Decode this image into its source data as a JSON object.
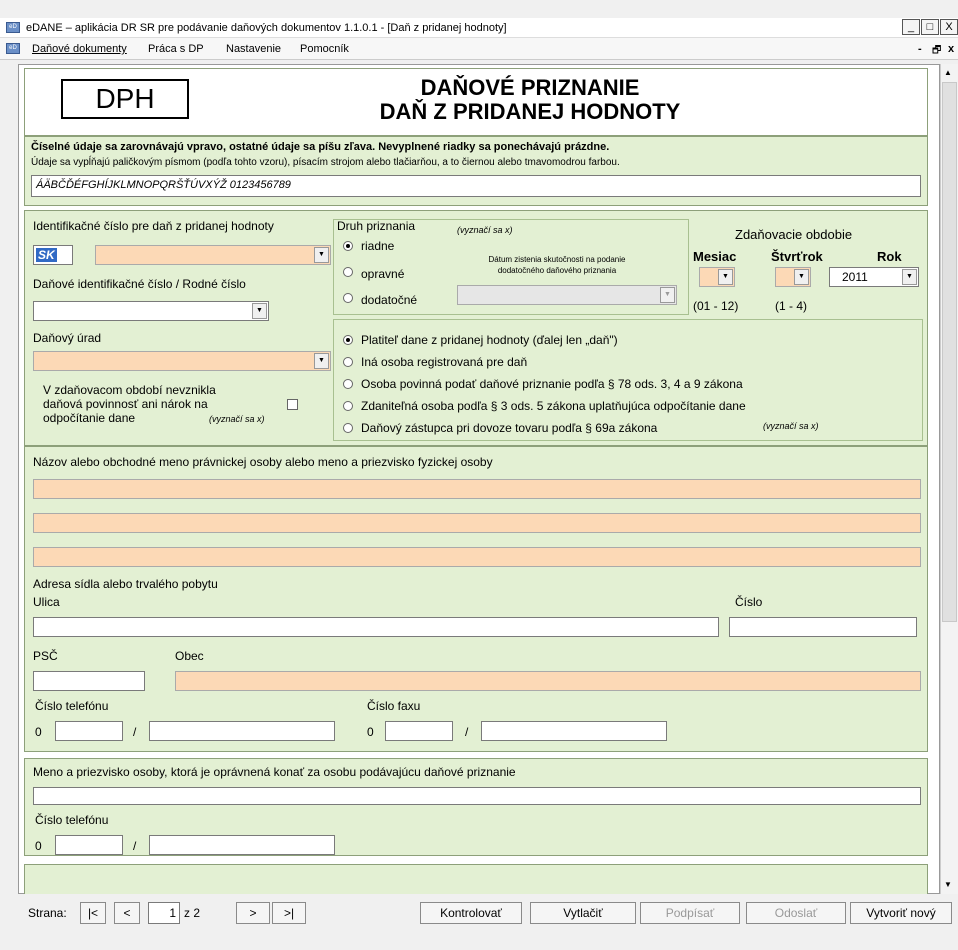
{
  "window": {
    "title": "eDANE – aplikácia DR SR pre podávanie daňových dokumentov  1.1.0.1 - [Daň z pridanej hodnoty]",
    "min": "_",
    "max": "□",
    "close": "X"
  },
  "menu": {
    "items": [
      "Daňové dokumenty",
      "Práca s DP",
      "Nastavenie",
      "Pomocník"
    ],
    "min": "-",
    "restore": "🗗",
    "close": "x"
  },
  "header": {
    "dph_box": "DPH",
    "title1": "DAŇOVÉ PRIZNANIE",
    "title2": "DAŇ Z PRIDANEJ HODNOTY"
  },
  "instructions": {
    "line1": "Číselné údaje sa zarovnávajú vpravo, ostatné údaje sa píšu zľava. Nevyplnené riadky sa ponechávajú prázdne.",
    "line2": "Údaje sa vypĺňajú paličkovým písmom (podľa tohto vzoru), písacím strojom alebo tlačiarňou, a to čiernou alebo tmavomodrou farbou.",
    "sample": "ÁÄBČĎÉFGHÍJKLMNOPQRŠŤÚVXÝŽ 0123456789"
  },
  "ident": {
    "ic_dph_label": "Identifikačné číslo pre daň z pridanej hodnoty",
    "sk_value": "SK",
    "dic_label": "Daňové identifikačné číslo / Rodné číslo",
    "urad_label": "Daňový úrad",
    "nevznikla1": "V zdaňovacom období nevznikla",
    "nevznikla2": "daňová povinnosť ani nárok na",
    "nevznikla3": "odpočítanie dane",
    "vyznaci": "(vyznačí sa x)"
  },
  "druh": {
    "label": "Druh priznania",
    "vyznaci": "(vyznačí sa x)",
    "riadne": "riadne",
    "opravne": "opravné",
    "dodatocne": "dodatočné",
    "datum1": "Dátum zistenia skutočnosti na podanie",
    "datum2": "dodatočného daňového priznania"
  },
  "obdobie": {
    "label": "Zdaňovacie obdobie",
    "mesiac": "Mesiac",
    "stvrtrok": "Štvrťrok",
    "rok": "Rok",
    "rok_value": "2011",
    "mesiac_range": "(01 - 12)",
    "stvrtrok_range": "(1 - 4)"
  },
  "platitel": {
    "o1": "Platiteľ dane z pridanej hodnoty (ďalej len „daň\")",
    "o2": "Iná osoba registrovaná pre daň",
    "o3": "Osoba povinná podať daňové priznanie podľa § 78 ods. 3, 4 a 9 zákona",
    "o4": "Zdaniteľná osoba podľa § 3 ods. 5 zákona uplatňujúca odpočítanie dane",
    "o5": "Daňový zástupca pri dovoze tovaru podľa § 69a zákona",
    "vyznaci": "(vyznačí sa x)"
  },
  "nazov": {
    "label": "Názov alebo obchodné meno právnickej osoby alebo meno a priezvisko fyzickej osoby",
    "adresa": "Adresa sídla alebo trvalého pobytu",
    "ulica": "Ulica",
    "cislo": "Číslo",
    "psc": "PSČ",
    "obec": "Obec",
    "telefon": "Číslo telefónu",
    "fax": "Číslo faxu",
    "zero": "0",
    "slash": "/"
  },
  "osoba": {
    "label": "Meno a priezvisko osoby, ktorá je oprávnená konať za osobu podávajúcu daňové priznanie",
    "telefon": "Číslo telefónu",
    "zero": "0",
    "slash": "/"
  },
  "footer": {
    "strana": "Strana:",
    "first": "|<",
    "prev": "<",
    "page": "1",
    "of": "z 2",
    "next": ">",
    "last": ">|",
    "kontrolovat": "Kontrolovať",
    "vytlacit": "Vytlačiť",
    "podpisat": "Podpísať",
    "odoslat": "Odoslať",
    "vytvorit": "Vytvoriť nový"
  }
}
